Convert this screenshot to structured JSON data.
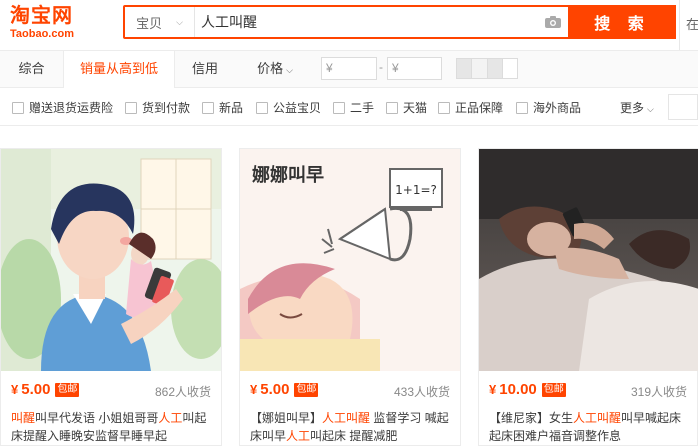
{
  "logo": {
    "cn": "淘宝网",
    "en": "Taobao.com"
  },
  "search": {
    "scope": "宝贝",
    "query": "人工叫醒",
    "button": "搜 索"
  },
  "topright": "在",
  "sort": {
    "items": [
      "综合",
      "销量从高到低",
      "信用",
      "价格"
    ],
    "price_from": "¥",
    "price_to": "¥",
    "dash": "-"
  },
  "filters": {
    "items": [
      "赠送退货运费险",
      "货到付款",
      "新品",
      "公益宝贝",
      "二手",
      "天猫",
      "正品保障",
      "海外商品"
    ],
    "more": "更多"
  },
  "products": [
    {
      "price_symbol": "¥",
      "price": "5.00",
      "tag": "包邮",
      "sold": "862人收货",
      "title_parts": [
        {
          "t": "叫醒",
          "hl": true
        },
        {
          "t": "叫早代发语 小姐姐哥哥",
          "hl": false
        },
        {
          "t": "人工",
          "hl": true
        },
        {
          "t": "叫起床提醒入睡晚安监督早睡早起",
          "hl": false
        }
      ]
    },
    {
      "price_symbol": "¥",
      "price": "5.00",
      "tag": "包邮",
      "sold": "433人收货",
      "image_text": "娜娜叫早",
      "image_math": "1+1=?",
      "title_parts": [
        {
          "t": "【娜姐叫早】",
          "hl": false
        },
        {
          "t": "人工叫醒",
          "hl": true
        },
        {
          "t": " 监督学习 喊起床叫早",
          "hl": false
        },
        {
          "t": "人工",
          "hl": true
        },
        {
          "t": "叫起床 提醒减肥",
          "hl": false
        }
      ]
    },
    {
      "price_symbol": "¥",
      "price": "10.00",
      "tag": "包邮",
      "sold": "319人收货",
      "title_parts": [
        {
          "t": "【维尼家】女生",
          "hl": false
        },
        {
          "t": "人工叫醒",
          "hl": true
        },
        {
          "t": "叫早喊起床起床困难户福音调整作息",
          "hl": false
        }
      ]
    }
  ],
  "colors": {
    "accent": "#ff4400",
    "text": "#3c3c3c",
    "muted": "#888888"
  }
}
